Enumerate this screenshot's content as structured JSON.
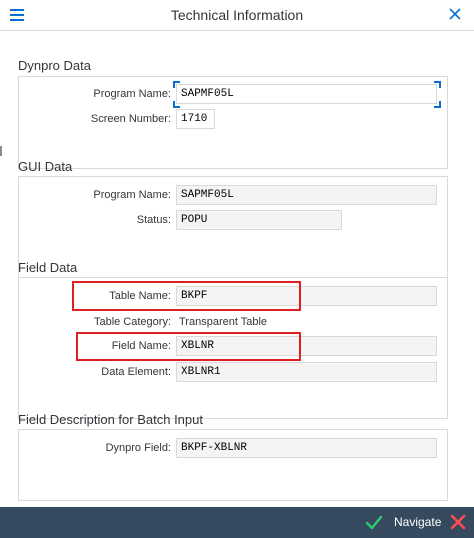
{
  "window": {
    "title": "Technical Information"
  },
  "dynpro_data": {
    "title": "Dynpro Data",
    "program_name_label": "Program Name:",
    "program_name_value": "SAPMF05L",
    "screen_number_label": "Screen Number:",
    "screen_number_value": "1710"
  },
  "gui_data": {
    "title": "GUI Data",
    "program_name_label": "Program Name:",
    "program_name_value": "SAPMF05L",
    "status_label": "Status:",
    "status_value": "POPU"
  },
  "field_data": {
    "title": "Field Data",
    "table_name_label": "Table Name:",
    "table_name_value": "BKPF",
    "table_category_label": "Table Category:",
    "table_category_value": "Transparent Table",
    "field_name_label": "Field Name:",
    "field_name_value": "XBLNR",
    "data_element_label": "Data Element:",
    "data_element_value": "XBLNR1"
  },
  "batch_input": {
    "title": "Field Description for Batch Input",
    "dynpro_field_label": "Dynpro Field:",
    "dynpro_field_value": "BKPF-XBLNR"
  },
  "footer": {
    "navigate_label": "Navigate"
  },
  "colors": {
    "accent": "#0a6ed1",
    "footer_bg": "#354a5f",
    "highlight_box": "#e02020",
    "ok_icon": "#2ecc71",
    "cancel_icon": "#ff4d4d"
  },
  "icons": {
    "menu": "hamburger-menu-icon",
    "close": "close-icon",
    "ok": "checkmark-icon",
    "cancel": "cancel-x-icon"
  }
}
